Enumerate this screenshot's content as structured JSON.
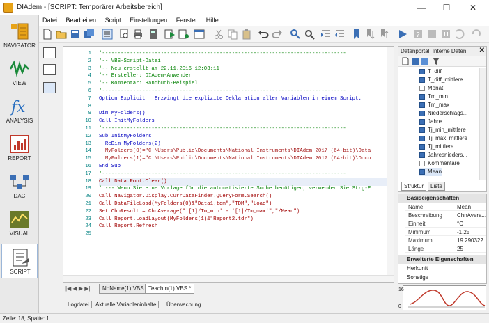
{
  "window": {
    "title": "DIAdem - [SCRIPT:  Temporärer Arbeitsbereich]",
    "minimize": "—",
    "maximize": "☐",
    "close": "✕"
  },
  "menu": [
    "Datei",
    "Bearbeiten",
    "Script",
    "Einstellungen",
    "Fenster",
    "Hilfe"
  ],
  "sidebar": [
    {
      "label": "NAVIGATOR",
      "icon": "navigator-icon"
    },
    {
      "label": "VIEW",
      "icon": "view-icon"
    },
    {
      "label": "ANALYSIS",
      "icon": "fx-icon"
    },
    {
      "label": "REPORT",
      "icon": "report-icon"
    },
    {
      "label": "DAC",
      "icon": "dac-icon"
    },
    {
      "label": "VISUAL",
      "icon": "visual-icon"
    },
    {
      "label": "SCRIPT",
      "icon": "script-icon"
    }
  ],
  "code": [
    {
      "n": "1",
      "t": "'-------------------------------------------------------------------------------",
      "c": "cm"
    },
    {
      "n": "2",
      "t": "'-- VBS-Script-Datei",
      "c": "cm"
    },
    {
      "n": "3",
      "t": "'-- Neu erstellt am 22.11.2016 12:03:11",
      "c": "cm"
    },
    {
      "n": "4",
      "t": "'-- Ersteller: DIAdem-Anwender",
      "c": "cm"
    },
    {
      "n": "5",
      "t": "'-- Kommentar: Handbuch-Beispiel",
      "c": "cm"
    },
    {
      "n": "6",
      "t": "'-------------------------------------------------------------------------------",
      "c": "cm"
    },
    {
      "n": "7",
      "t": "Option Explicit  'Erzwingt die explizite Deklaration aller Variablen in einem Script.",
      "c": "kw"
    },
    {
      "n": "8",
      "t": "",
      "c": ""
    },
    {
      "n": "9",
      "t": "Dim MyFolders()",
      "c": "kw"
    },
    {
      "n": "10",
      "t": "Call InitMyFolders",
      "c": "kw"
    },
    {
      "n": "11",
      "t": "'-------------------------------------------------------------------------------",
      "c": "cm"
    },
    {
      "n": "12",
      "t": "Sub InitMyFolders",
      "c": "kw"
    },
    {
      "n": "13",
      "t": "  ReDim MyFolders(2)",
      "c": "kw"
    },
    {
      "n": "14",
      "t": "  MyFolders(0)=\"C:\\Users\\Public\\Documents\\National Instruments\\DIAdem 2017 (64-bit)\\Data",
      "c": "st"
    },
    {
      "n": "15",
      "t": "  MyFolders(1)=\"C:\\Users\\Public\\Documents\\National Instruments\\DIAdem 2017 (64-bit)\\Docu",
      "c": "st"
    },
    {
      "n": "16",
      "t": "End Sub",
      "c": "kw"
    },
    {
      "n": "17",
      "t": "'-------------------------------------------------------------------------------",
      "c": "cm"
    },
    {
      "n": "18",
      "t": "Call Data.Root.Clear()",
      "c": "fn"
    },
    {
      "n": "19",
      "t": "' --- Wenn Sie eine Vorlage für die automatisierte Suche benötigen, verwenden Sie Strg-E",
      "c": "cm"
    },
    {
      "n": "20",
      "t": "Call Navigator.Display.CurrDataFinder.QueryForm.Search()",
      "c": "fn"
    },
    {
      "n": "21",
      "t": "Call DataFileLoad(MyFolders(0)&\"Data1.tdm\",\"TDM\",\"Load\")",
      "c": "fn"
    },
    {
      "n": "22",
      "t": "Set ChnResult = ChnAverage(\"'[1]/Tm_min' - '[1]/Tm_max'\",\"/Mean\")",
      "c": "fn"
    },
    {
      "n": "23",
      "t": "Call Report.LoadLayout(MyFolders(1)&\"Report2.tdr\")",
      "c": "fn"
    },
    {
      "n": "24",
      "t": "Call Report.Refresh",
      "c": "fn"
    },
    {
      "n": "25",
      "t": "",
      "c": ""
    }
  ],
  "tabs": {
    "nav": "|◀ ◀ ▶ ▶|",
    "tab1": "NoName(1).VBS",
    "tab2": "TeachIn(1).VBS *"
  },
  "output_tabs": [
    "Logdatei",
    "Aktuelle Variableninhalte",
    "Überwachung"
  ],
  "status": "Zeile: 18, Spalte: 1",
  "portal": {
    "title": "Datenportal: Interne Daten",
    "close": "✕",
    "tabs": [
      "Struktur",
      "Liste"
    ],
    "items": [
      "T_diff",
      "T_diff_mittlere",
      "Monat",
      "Tm_min",
      "Tm_max",
      "Niederschlags...",
      "Jahre",
      "Tj_min_mittlere",
      "Tj_max_mittlere",
      "Tj_mittlere",
      "Jahresnieders...",
      "Kommentare",
      "Mean"
    ]
  },
  "props": {
    "sections": [
      "Basiseigenschaften",
      "Erweiterte Eigenschaften",
      "Herkunft",
      "Sonstige"
    ],
    "rows": [
      {
        "k": "Name",
        "v": "Mean"
      },
      {
        "k": "Beschreibung",
        "v": "ChnAvera..."
      },
      {
        "k": "Einheit",
        "v": "°C"
      },
      {
        "k": "Minimum",
        "v": "-1.25"
      },
      {
        "k": "Maximum",
        "v": "19.290322..."
      },
      {
        "k": "Länge",
        "v": "25"
      }
    ]
  },
  "mini_chart": {
    "y_top": "16",
    "y_bottom": "0"
  },
  "colors": {
    "accent": "#3b6fb5",
    "comment": "#008000",
    "keyword": "#0000c0"
  }
}
